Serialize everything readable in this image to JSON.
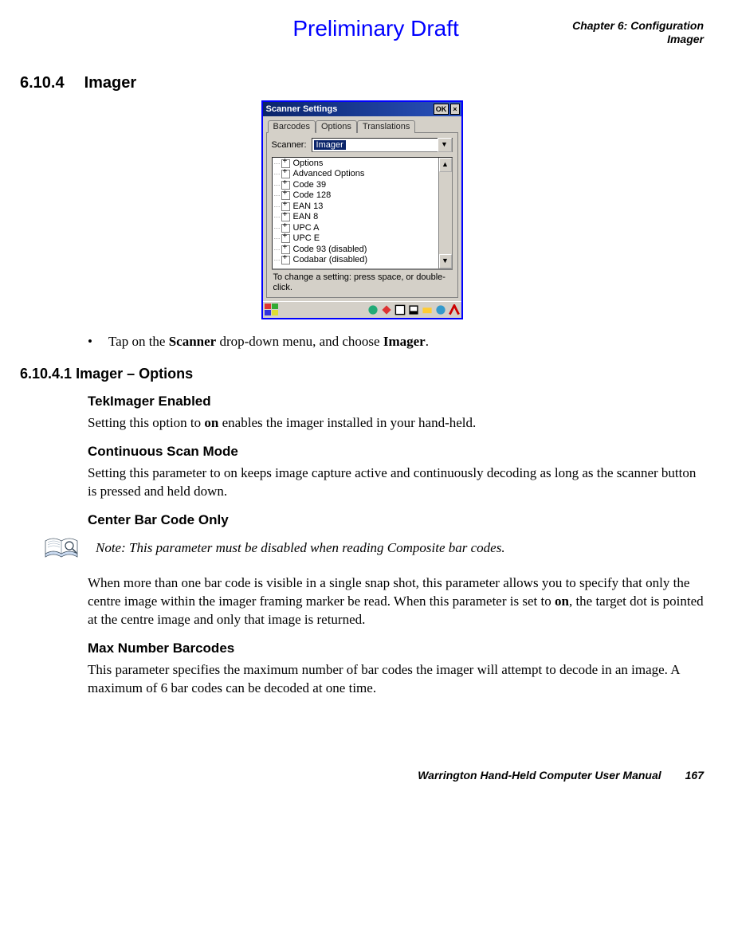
{
  "header": {
    "preliminary": "Preliminary Draft",
    "chapter_line1": "Chapter 6:  Configuration",
    "chapter_line2": "Imager"
  },
  "section": {
    "number": "6.10.4",
    "title": "Imager"
  },
  "screenshot": {
    "title": "Scanner Settings",
    "ok": "OK",
    "close": "×",
    "tabs": [
      "Barcodes",
      "Options",
      "Translations"
    ],
    "scanner_label": "Scanner:",
    "scanner_value": "Imager",
    "tree": [
      "Options",
      "Advanced Options",
      "Code 39",
      "Code 128",
      "EAN 13",
      "EAN 8",
      "UPC A",
      "UPC E",
      "Code 93 (disabled)",
      "Codabar (disabled)"
    ],
    "hint": "To change a setting: press space, or double-click."
  },
  "bullet": {
    "pre": "Tap on the ",
    "b1": "Scanner",
    "mid": " drop-down menu, and choose ",
    "b2": "Imager",
    "post": "."
  },
  "subsection": {
    "number": "6.10.4.1",
    "title": "Imager – Options"
  },
  "tek": {
    "heading": "TekImager Enabled",
    "p_pre": "Setting this option to ",
    "p_b": "on",
    "p_post": " enables the imager installed in your hand-held."
  },
  "cont": {
    "heading": "Continuous Scan Mode",
    "p": "Setting this parameter to on keeps image capture active and continuously decoding as long as the scanner button is pressed and held down."
  },
  "center": {
    "heading": "Center Bar Code Only",
    "note": "Note: This parameter must be disabled when reading Composite bar codes.",
    "p_pre": "When more than one bar code is visible in a single snap shot, this parameter allows you to specify that only the centre image within the imager framing marker be read. When this parameter is set to ",
    "p_b": "on",
    "p_post": ", the target dot is pointed at the centre image and only that image is returned."
  },
  "max": {
    "heading": "Max Number Barcodes",
    "p": "This parameter specifies the maximum number of bar codes the imager will attempt to decode in an image. A maximum of 6 bar codes can be decoded at one time."
  },
  "footer": {
    "title": "Warrington Hand-Held Computer User Manual",
    "page": "167"
  }
}
